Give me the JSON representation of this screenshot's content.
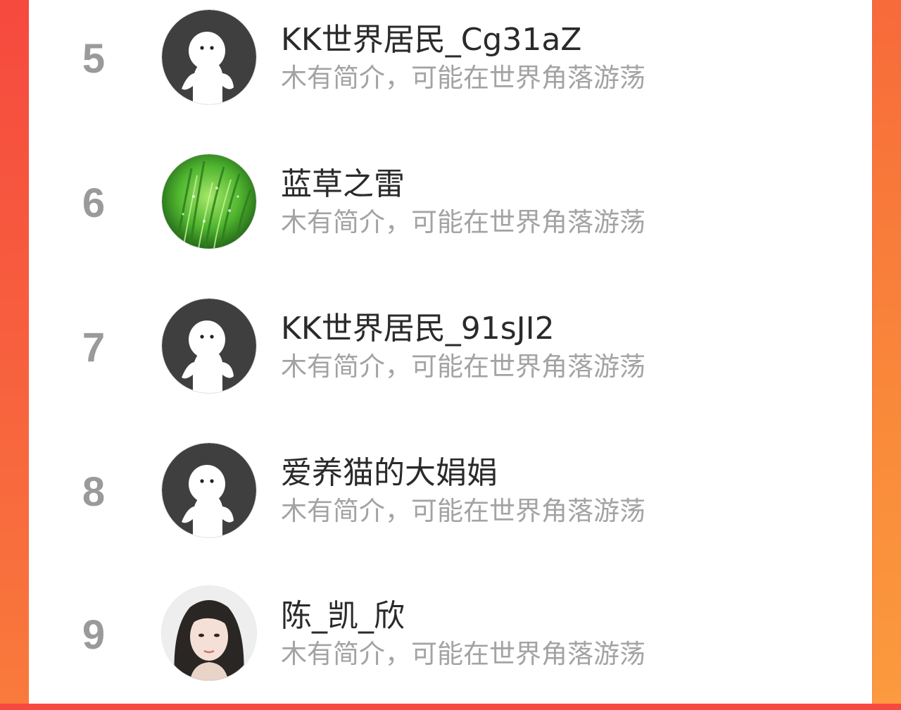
{
  "colors": {
    "background_gradient_start": "#f6493f",
    "background_gradient_end": "#f97a3c",
    "rank_color": "#9a9a9a",
    "name_color": "#2a2a2a",
    "bio_color": "#a3a3a3",
    "default_avatar_bg": "#3f3f3f"
  },
  "ranking": {
    "items": [
      {
        "rank": "5",
        "name": "KK世界居民_Cg31aZ",
        "bio": "木有简介，可能在世界角落游荡",
        "avatar": "default-ghost-avatar"
      },
      {
        "rank": "6",
        "name": "蓝草之雷",
        "bio": "木有简介，可能在世界角落游荡",
        "avatar": "grass-photo-avatar"
      },
      {
        "rank": "7",
        "name": "KK世界居民_91sJI2",
        "bio": "木有简介，可能在世界角落游荡",
        "avatar": "default-ghost-avatar"
      },
      {
        "rank": "8",
        "name": "爱养猫的大娟娟",
        "bio": "木有简介，可能在世界角落游荡",
        "avatar": "default-ghost-avatar"
      },
      {
        "rank": "9",
        "name": "陈_凯_欣",
        "bio": "木有简介，可能在世界角落游荡",
        "avatar": "portrait-photo-avatar"
      }
    ]
  }
}
